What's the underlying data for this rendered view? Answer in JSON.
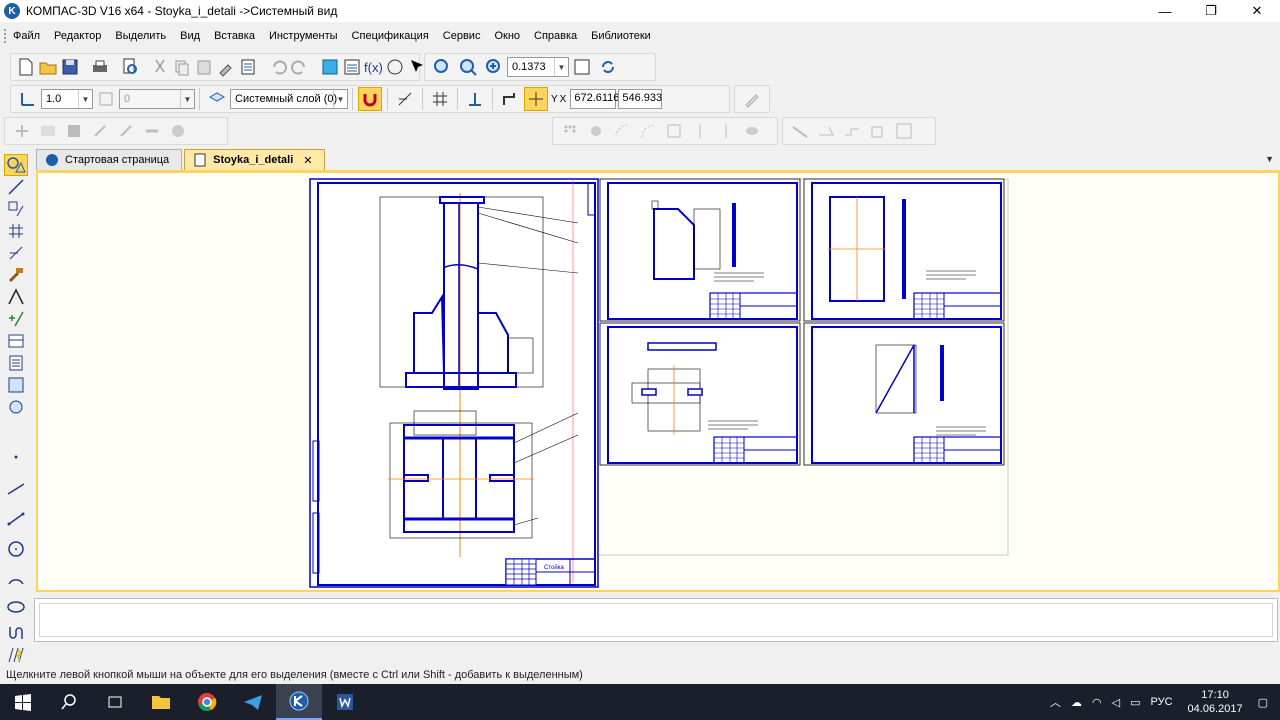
{
  "window": {
    "title": "КОМПАС-3D V16  x64 - Stoyka_i_detali ->Системный вид",
    "minimize": "—",
    "maximize": "❐",
    "close": "✕"
  },
  "menu": [
    "Файл",
    "Редактор",
    "Выделить",
    "Вид",
    "Вставка",
    "Инструменты",
    "Спецификация",
    "Сервис",
    "Окно",
    "Справка",
    "Библиотеки"
  ],
  "toolbar": {
    "zoom_value": "0.1373",
    "step_value": "1.0",
    "angle_value": "0",
    "layer_value": "Системный слой (0)",
    "coord_y_label": "Y",
    "coord_x_label": "X",
    "coord_x": "672.6116",
    "coord_y": "546.933",
    "fx_label": "f(x)"
  },
  "tabs": [
    {
      "label": "Стартовая страница",
      "active": false
    },
    {
      "label": "Stoyka_i_detali",
      "active": true,
      "close": "✕"
    }
  ],
  "drawing": {
    "main_title": "Стойка"
  },
  "status_text": "Щелкните левой кнопкой мыши на объекте для его выделения (вместе с Ctrl или Shift - добавить к выделенным)",
  "taskbar": {
    "lang": "РУС",
    "time": "17:10",
    "date": "04.06.2017"
  },
  "colors": {
    "accent": "#ffd35c",
    "drawing_line": "#0000c8",
    "axis_line": "#ff8000",
    "taskbar": "#1a1f2b"
  }
}
